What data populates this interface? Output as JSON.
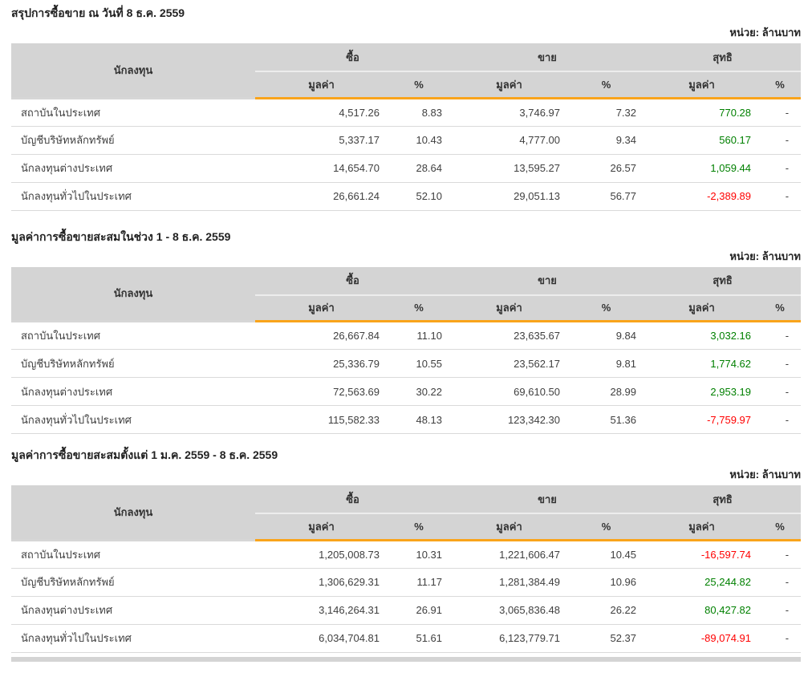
{
  "unit_label": "หน่วย: ล้านบาท",
  "columns": {
    "investor": "นักลงทุน",
    "buy": "ซื้อ",
    "sell": "ขาย",
    "net": "สุทธิ",
    "value": "มูลค่า",
    "percent": "%"
  },
  "colors": {
    "header_bg": "#d4d4d4",
    "accent_orange": "#f9a41b",
    "positive_green": "#008000",
    "negative_red": "#ff0000",
    "row_border": "#dadada"
  },
  "tables": [
    {
      "title": "สรุปการซื้อขาย ณ วันที่ 8 ธ.ค. 2559",
      "rows": [
        {
          "investor": "สถาบันในประเทศ",
          "buy_value": "4,517.26",
          "buy_pct": "8.83",
          "sell_value": "3,746.97",
          "sell_pct": "7.32",
          "net_value": "770.28",
          "net_pct": "-"
        },
        {
          "investor": "บัญชีบริษัทหลักทรัพย์",
          "buy_value": "5,337.17",
          "buy_pct": "10.43",
          "sell_value": "4,777.00",
          "sell_pct": "9.34",
          "net_value": "560.17",
          "net_pct": "-"
        },
        {
          "investor": "นักลงทุนต่างประเทศ",
          "buy_value": "14,654.70",
          "buy_pct": "28.64",
          "sell_value": "13,595.27",
          "sell_pct": "26.57",
          "net_value": "1,059.44",
          "net_pct": "-"
        },
        {
          "investor": "นักลงทุนทั่วไปในประเทศ",
          "buy_value": "26,661.24",
          "buy_pct": "52.10",
          "sell_value": "29,051.13",
          "sell_pct": "56.77",
          "net_value": "-2,389.89",
          "net_pct": "-"
        }
      ]
    },
    {
      "title": "มูลค่าการซื้อขายสะสมในช่วง 1 - 8 ธ.ค. 2559",
      "rows": [
        {
          "investor": "สถาบันในประเทศ",
          "buy_value": "26,667.84",
          "buy_pct": "11.10",
          "sell_value": "23,635.67",
          "sell_pct": "9.84",
          "net_value": "3,032.16",
          "net_pct": "-"
        },
        {
          "investor": "บัญชีบริษัทหลักทรัพย์",
          "buy_value": "25,336.79",
          "buy_pct": "10.55",
          "sell_value": "23,562.17",
          "sell_pct": "9.81",
          "net_value": "1,774.62",
          "net_pct": "-"
        },
        {
          "investor": "นักลงทุนต่างประเทศ",
          "buy_value": "72,563.69",
          "buy_pct": "30.22",
          "sell_value": "69,610.50",
          "sell_pct": "28.99",
          "net_value": "2,953.19",
          "net_pct": "-"
        },
        {
          "investor": "นักลงทุนทั่วไปในประเทศ",
          "buy_value": "115,582.33",
          "buy_pct": "48.13",
          "sell_value": "123,342.30",
          "sell_pct": "51.36",
          "net_value": "-7,759.97",
          "net_pct": "-"
        }
      ]
    },
    {
      "title": "มูลค่าการซื้อขายสะสมตั้งแต่ 1 ม.ค. 2559 - 8 ธ.ค. 2559",
      "rows": [
        {
          "investor": "สถาบันในประเทศ",
          "buy_value": "1,205,008.73",
          "buy_pct": "10.31",
          "sell_value": "1,221,606.47",
          "sell_pct": "10.45",
          "net_value": "-16,597.74",
          "net_pct": "-"
        },
        {
          "investor": "บัญชีบริษัทหลักทรัพย์",
          "buy_value": "1,306,629.31",
          "buy_pct": "11.17",
          "sell_value": "1,281,384.49",
          "sell_pct": "10.96",
          "net_value": "25,244.82",
          "net_pct": "-"
        },
        {
          "investor": "นักลงทุนต่างประเทศ",
          "buy_value": "3,146,264.31",
          "buy_pct": "26.91",
          "sell_value": "3,065,836.48",
          "sell_pct": "26.22",
          "net_value": "80,427.82",
          "net_pct": "-"
        },
        {
          "investor": "นักลงทุนทั่วไปในประเทศ",
          "buy_value": "6,034,704.81",
          "buy_pct": "51.61",
          "sell_value": "6,123,779.71",
          "sell_pct": "52.37",
          "net_value": "-89,074.91",
          "net_pct": "-"
        }
      ]
    }
  ]
}
